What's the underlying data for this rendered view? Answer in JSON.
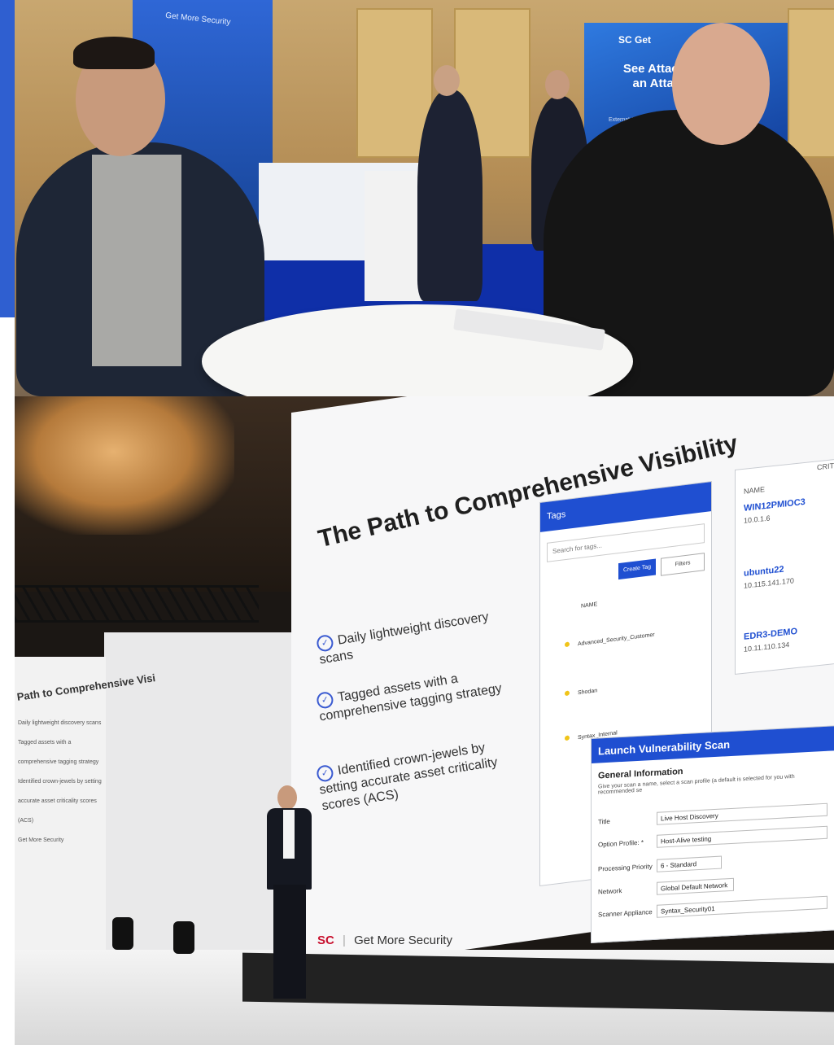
{
  "top_photo": {
    "banner_left_text": "Get More Security",
    "booth_logo": "SC Get",
    "booth_title": "See Attack S an Attack",
    "booth_subtitle": "External Attack Su"
  },
  "bottom_photo": {
    "slide_title": "The Path to Comprehensive Visibility",
    "bullets": [
      "Daily lightweight discovery scans",
      "Tagged assets with a comprehensive tagging strategy",
      "Identified crown-jewels by setting accurate asset criticality scores (ACS)"
    ],
    "side_screen_title": "Path to Comprehensive Visi",
    "side_screen_lines": [
      "Daily lightweight discovery scans",
      "Tagged assets with a comprehensive tagging strategy",
      "Identified crown-jewels by setting accurate asset criticality scores (ACS)",
      "Get More Security"
    ],
    "tags_panel": {
      "header": "Tags",
      "search_placeholder": "Search for tags...",
      "create_tag": "Create Tag",
      "filters": "Filters",
      "column_name": "NAME",
      "rows": [
        "Advanced_Security_Customer",
        "Shodan",
        "Syntax_Internal"
      ]
    },
    "assets_panel": {
      "column_name": "NAME",
      "column_crit": "CRIT",
      "assets": [
        {
          "name": "WIN12PMIOC3",
          "ip": "10.0.1.6"
        },
        {
          "name": "ubuntu22",
          "ip": "10.115.141.170"
        },
        {
          "name": "EDR3-DEMO",
          "ip": "10.11.110.134"
        }
      ]
    },
    "scan_panel": {
      "header": "Launch Vulnerability Scan",
      "section": "General Information",
      "description": "Give your scan a name, select a scan profile (a default is selected for you with recommended se",
      "fields": [
        {
          "label": "Title",
          "value": "Live Host Discovery"
        },
        {
          "label": "Option Profile: *",
          "value": "Host-Alive testing"
        },
        {
          "label": "Processing Priority",
          "value": "6 - Standard"
        },
        {
          "label": "Network",
          "value": "Global Default Network"
        },
        {
          "label": "Scanner Appliance",
          "value": "Syntax_Security01"
        }
      ]
    },
    "footer_logo_mark": "SC",
    "footer_tagline": "Get More Security"
  },
  "colors": {
    "accent": "#2f5fd0",
    "brand_blue": "#1f4fd1",
    "brand_red": "#c8102e"
  }
}
